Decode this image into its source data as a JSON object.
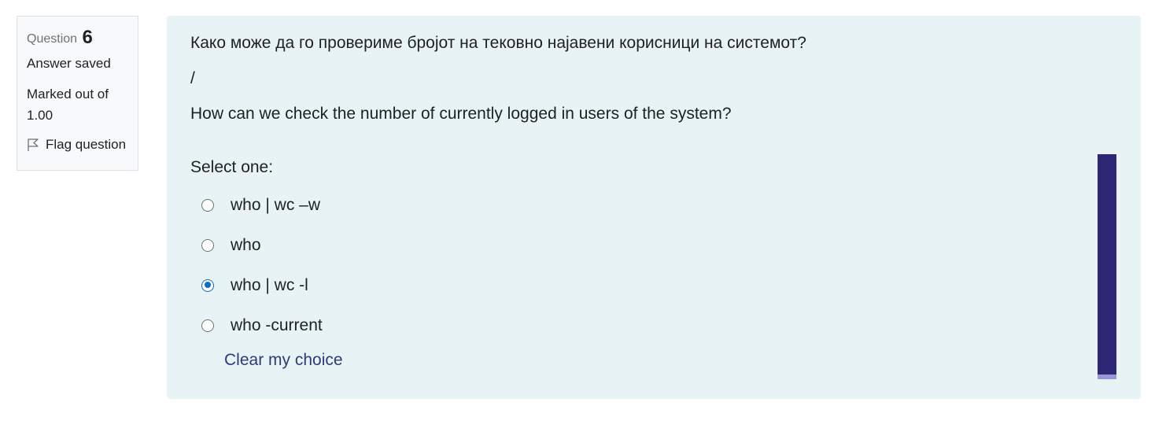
{
  "info": {
    "question_label": "Question",
    "question_number": "6",
    "state": "Answer saved",
    "grade": "Marked out of 1.00",
    "flag_label": "Flag question"
  },
  "question": {
    "text_mk": "Како може да го провериме бројот на тековно најавени корисници на системот?",
    "separator": "/",
    "text_en": "How can we check the number of currently logged in users of the system?",
    "prompt": "Select one:",
    "options": [
      {
        "label": "who | wc –w",
        "selected": false
      },
      {
        "label": "who",
        "selected": false
      },
      {
        "label": "who | wc -l",
        "selected": true
      },
      {
        "label": "who -current",
        "selected": false
      }
    ],
    "clear_label": "Clear my choice"
  },
  "colors": {
    "accent": "#0f6cbf",
    "link": "#2e3b7a",
    "content_bg": "#e7f3f5",
    "scroll_thumb": "#2d2873",
    "scroll_track": "#9c93d8"
  },
  "icons": {
    "flag": "flag-icon"
  }
}
